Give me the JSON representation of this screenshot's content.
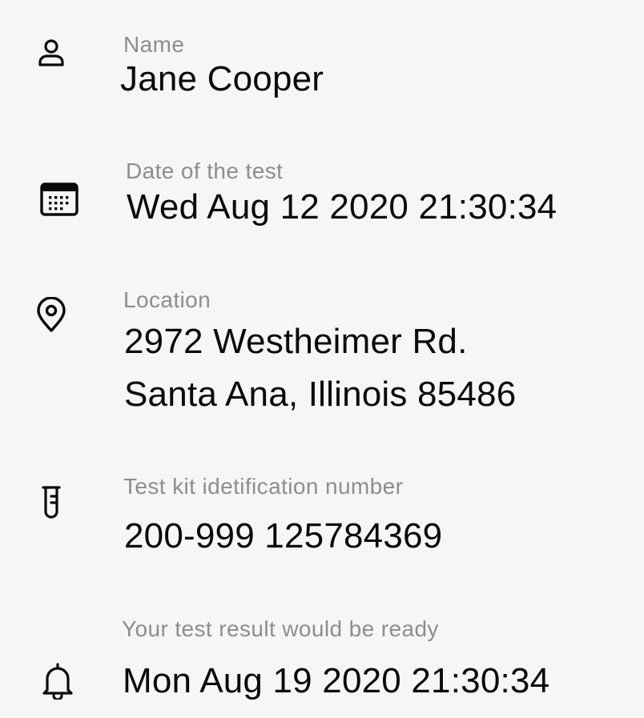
{
  "fields": {
    "name": {
      "icon": "person-icon",
      "label": "Name",
      "value": "Jane Cooper"
    },
    "date": {
      "icon": "calendar-icon",
      "label": "Date of the test",
      "value": "Wed Aug 12 2020 21:30:34"
    },
    "location": {
      "icon": "location-pin-icon",
      "label": "Location",
      "line1": "2972 Westheimer Rd.",
      "line2": "Santa Ana, Illinois 85486"
    },
    "kit": {
      "icon": "test-tube-icon",
      "label": "Test kit idetification number",
      "value": "200-999 125784369"
    },
    "result": {
      "icon": "bell-icon",
      "label": "Your test result would be ready",
      "value": "Mon Aug 19 2020 21:30:34"
    }
  }
}
